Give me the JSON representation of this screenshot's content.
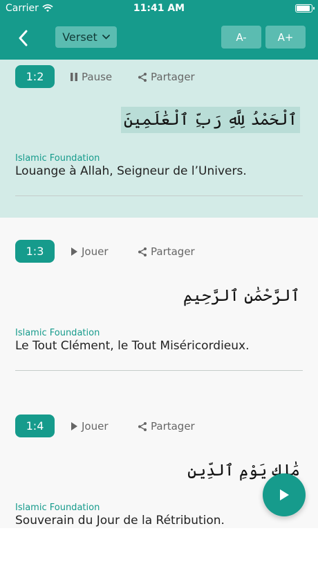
{
  "status_bar": {
    "carrier": "Carrier",
    "time": "11:41 AM"
  },
  "toolbar": {
    "view_mode": "Verset",
    "font_decrease_label": "A-",
    "font_increase_label": "A+"
  },
  "verses": [
    {
      "number": "1:2",
      "play_label": "Pause",
      "play_icon": "pause-icon",
      "share_label": "Partager",
      "arabic": "ٱلْحَمْدُ لِلَّهِ رَبِّ ٱلْعَٰلَمِينَ",
      "source": "Islamic Foundation",
      "translation": "Louange à Allah, Seigneur de l’Univers.",
      "active": true
    },
    {
      "number": "1:3",
      "play_label": "Jouer",
      "play_icon": "play-icon",
      "share_label": "Partager",
      "arabic": "ٱلرَّحْمَٰنِ ٱلرَّحِيمِ",
      "source": "Islamic Foundation",
      "translation": "Le Tout Clément, le Tout Miséricordieux.",
      "active": false
    },
    {
      "number": "1:4",
      "play_label": "Jouer",
      "play_icon": "play-icon",
      "share_label": "Partager",
      "arabic": "مَٰلِكِ يَوْمِ ٱلدِّينِ",
      "source": "Islamic Foundation",
      "translation": "Souverain du Jour de la Rétribution.",
      "active": false
    }
  ],
  "colors": {
    "accent": "#169b8c",
    "active_row": "#d3ebe7",
    "arabic_highlight": "#b9ddd7"
  }
}
